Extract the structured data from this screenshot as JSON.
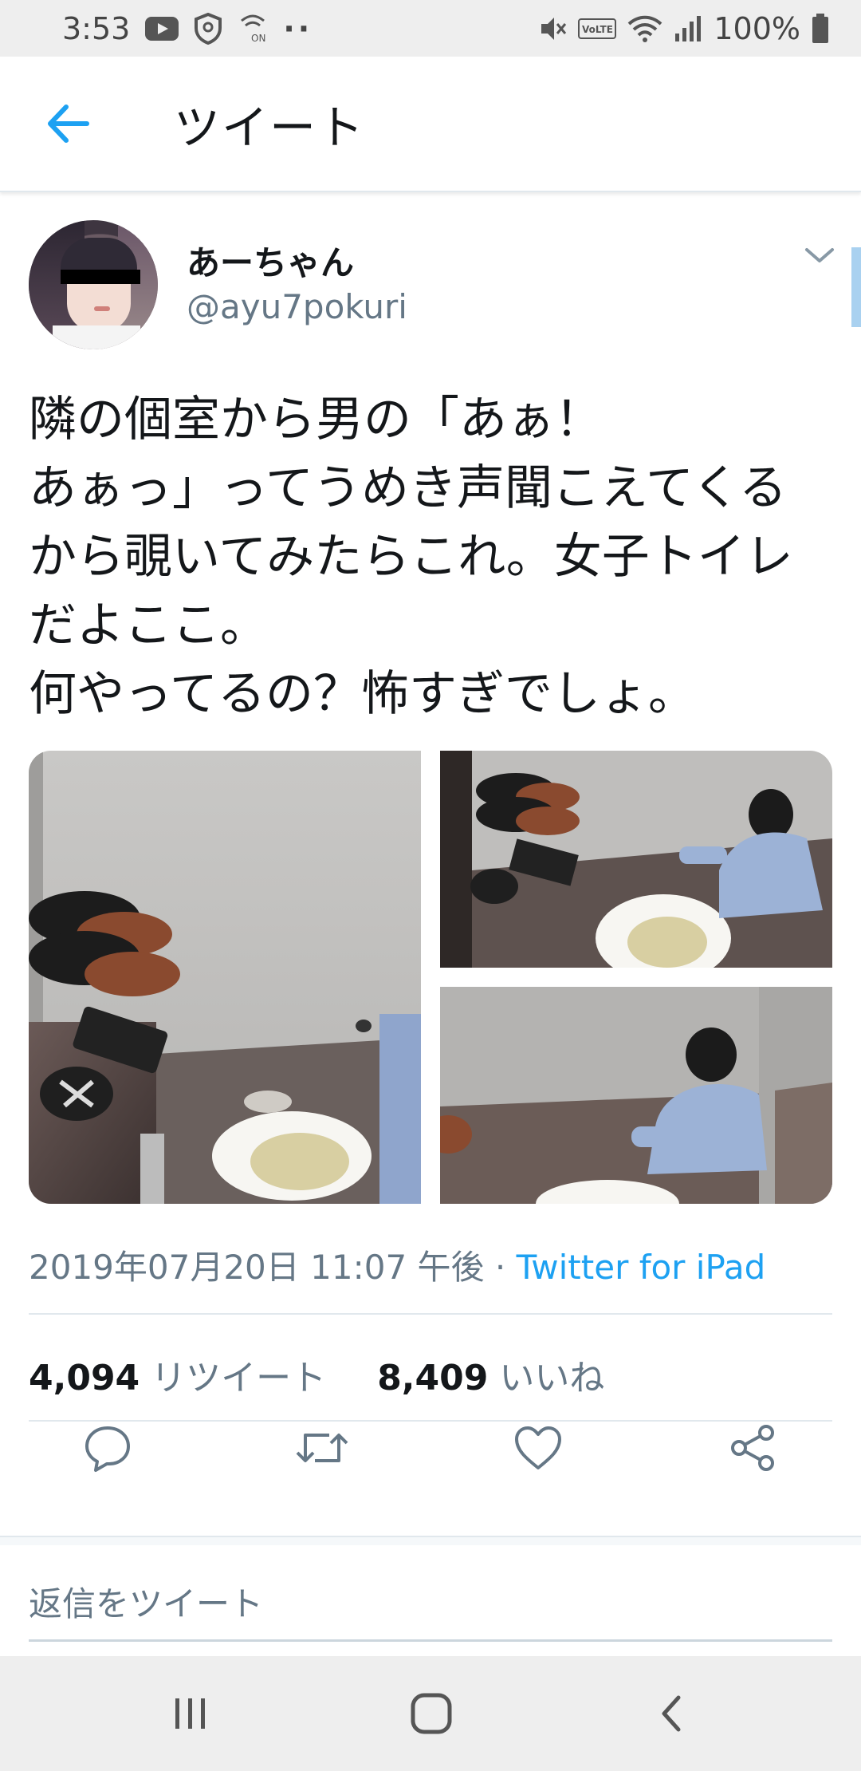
{
  "status_bar": {
    "time": "3:53",
    "battery": "100%",
    "left_icons": [
      "youtube-icon",
      "shield-icon",
      "wifi-calling-icon"
    ],
    "right_icons": [
      "mute-icon",
      "volte-icon",
      "wifi-icon",
      "signal-icon",
      "battery-icon"
    ],
    "volte_label": "VoLTE",
    "more_dots": "··"
  },
  "header": {
    "title": "ツイート",
    "back_icon": "arrow-left-icon"
  },
  "tweet": {
    "display_name": "あーちゃん",
    "handle": "@ayu7pokuri",
    "text": "隣の個室から男の「あぁ！\nあぁっ」ってうめき声聞こえてくる\nから覗いてみたらこれ。女子トイレ\nだよここ。\n何やってるの？怖すぎでしょ。",
    "timestamp": "2019年07月20日 11:07 午後",
    "separator": " · ",
    "source": "Twitter for iPad",
    "retweet_count": "4,094",
    "retweet_label": "リツイート",
    "like_count": "8,409",
    "like_label": "いいね"
  },
  "actions": {
    "reply_icon": "reply-icon",
    "retweet_icon": "retweet-icon",
    "like_icon": "heart-icon",
    "share_icon": "share-icon"
  },
  "reply_box": {
    "placeholder": "返信をツイート"
  },
  "nav_bar": {
    "recents_icon": "recent-apps-icon",
    "home_icon": "home-icon",
    "back_icon": "back-icon"
  },
  "colors": {
    "accent": "#1da1f2",
    "text": "#14171a",
    "secondary": "#657786",
    "divider": "#e1e8ed"
  }
}
